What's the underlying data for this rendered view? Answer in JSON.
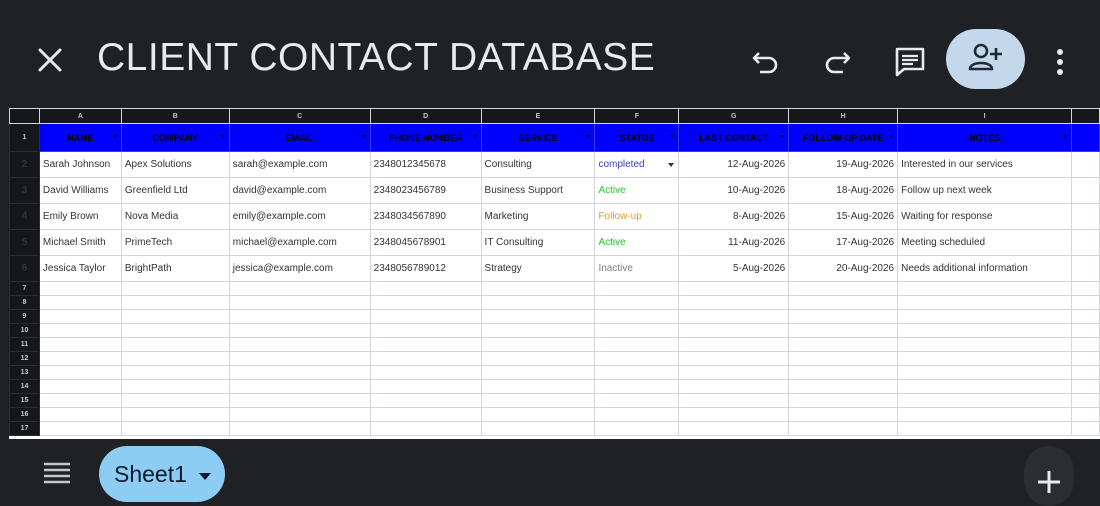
{
  "app": {
    "title": "CLIENT CONTACT DATABASE",
    "colors": {
      "header_blue": "#0000ff",
      "completed": "#3c3cc6",
      "active": "#27c427",
      "follow_up": "#e0a020",
      "inactive": "#808080",
      "share_bg": "#c3d8ea",
      "sheet_tab_bg": "#8ecdf3"
    }
  },
  "toolbar": {
    "icons": [
      "close-icon",
      "undo-icon",
      "redo-icon",
      "comment-icon",
      "add-person-icon",
      "more-vert-icon"
    ]
  },
  "grid": {
    "column_letters": [
      "A",
      "B",
      "C",
      "D",
      "E",
      "F",
      "G",
      "H",
      "I"
    ],
    "row_numbers": [
      "1",
      "2",
      "3",
      "4",
      "5",
      "6",
      "7",
      "8",
      "9",
      "10",
      "11",
      "12",
      "13",
      "14",
      "15",
      "16",
      "17"
    ],
    "headers": [
      "NAME",
      "COMPANY",
      "EMAIL",
      "PHONE NUMBER",
      "SERVICE",
      "STATUS",
      "LAST CONTACT",
      "FOLLOW-UP DATE",
      "NOTES"
    ],
    "rows": [
      [
        "Sarah Johnson",
        "Apex Solutions",
        "sarah@example.com",
        "2348012345678",
        "Consulting",
        "completed",
        "12-Aug-2026",
        "19-Aug-2026",
        "Interested in our services"
      ],
      [
        "David Williams",
        "Greenfield Ltd",
        "david@example.com",
        "2348023456789",
        "Business Support",
        "Active",
        "10-Aug-2026",
        "18-Aug-2026",
        "Follow up next week"
      ],
      [
        "Emily Brown",
        "Nova Media",
        "emily@example.com",
        "2348034567890",
        "Marketing",
        "Follow-up",
        "8-Aug-2026",
        "15-Aug-2026",
        "Waiting for response"
      ],
      [
        "Michael Smith",
        "PrimeTech",
        "michael@example.com",
        "2348045678901",
        "IT Consulting",
        "Active",
        "11-Aug-2026",
        "17-Aug-2026",
        "Meeting scheduled"
      ],
      [
        "Jessica Taylor",
        "BrightPath",
        "jessica@example.com",
        "2348056789012",
        "Strategy",
        "Inactive",
        "5-Aug-2026",
        "20-Aug-2026",
        "Needs additional information"
      ]
    ]
  },
  "bottom": {
    "sheet_name": "Sheet1",
    "icons": [
      "sheets-list-icon",
      "dropdown-icon",
      "add-icon"
    ]
  }
}
